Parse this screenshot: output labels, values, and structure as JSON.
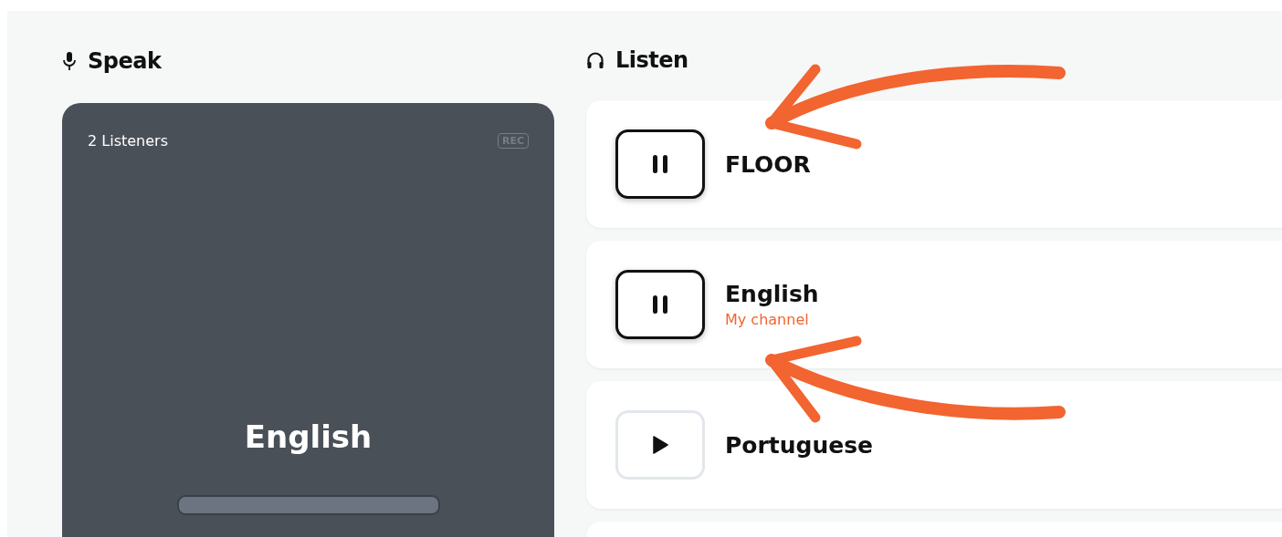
{
  "speak": {
    "title": "Speak",
    "panel": {
      "listeners": "2 Listeners",
      "rec": {
        "label": "REC",
        "active": false
      },
      "language": "English"
    }
  },
  "listen": {
    "title": "Listen",
    "channels": [
      {
        "name": "FLOOR",
        "playing": true
      },
      {
        "name": "English",
        "subtitle": "My channel",
        "playing": true
      },
      {
        "name": "Portuguese",
        "playing": false
      }
    ]
  }
}
